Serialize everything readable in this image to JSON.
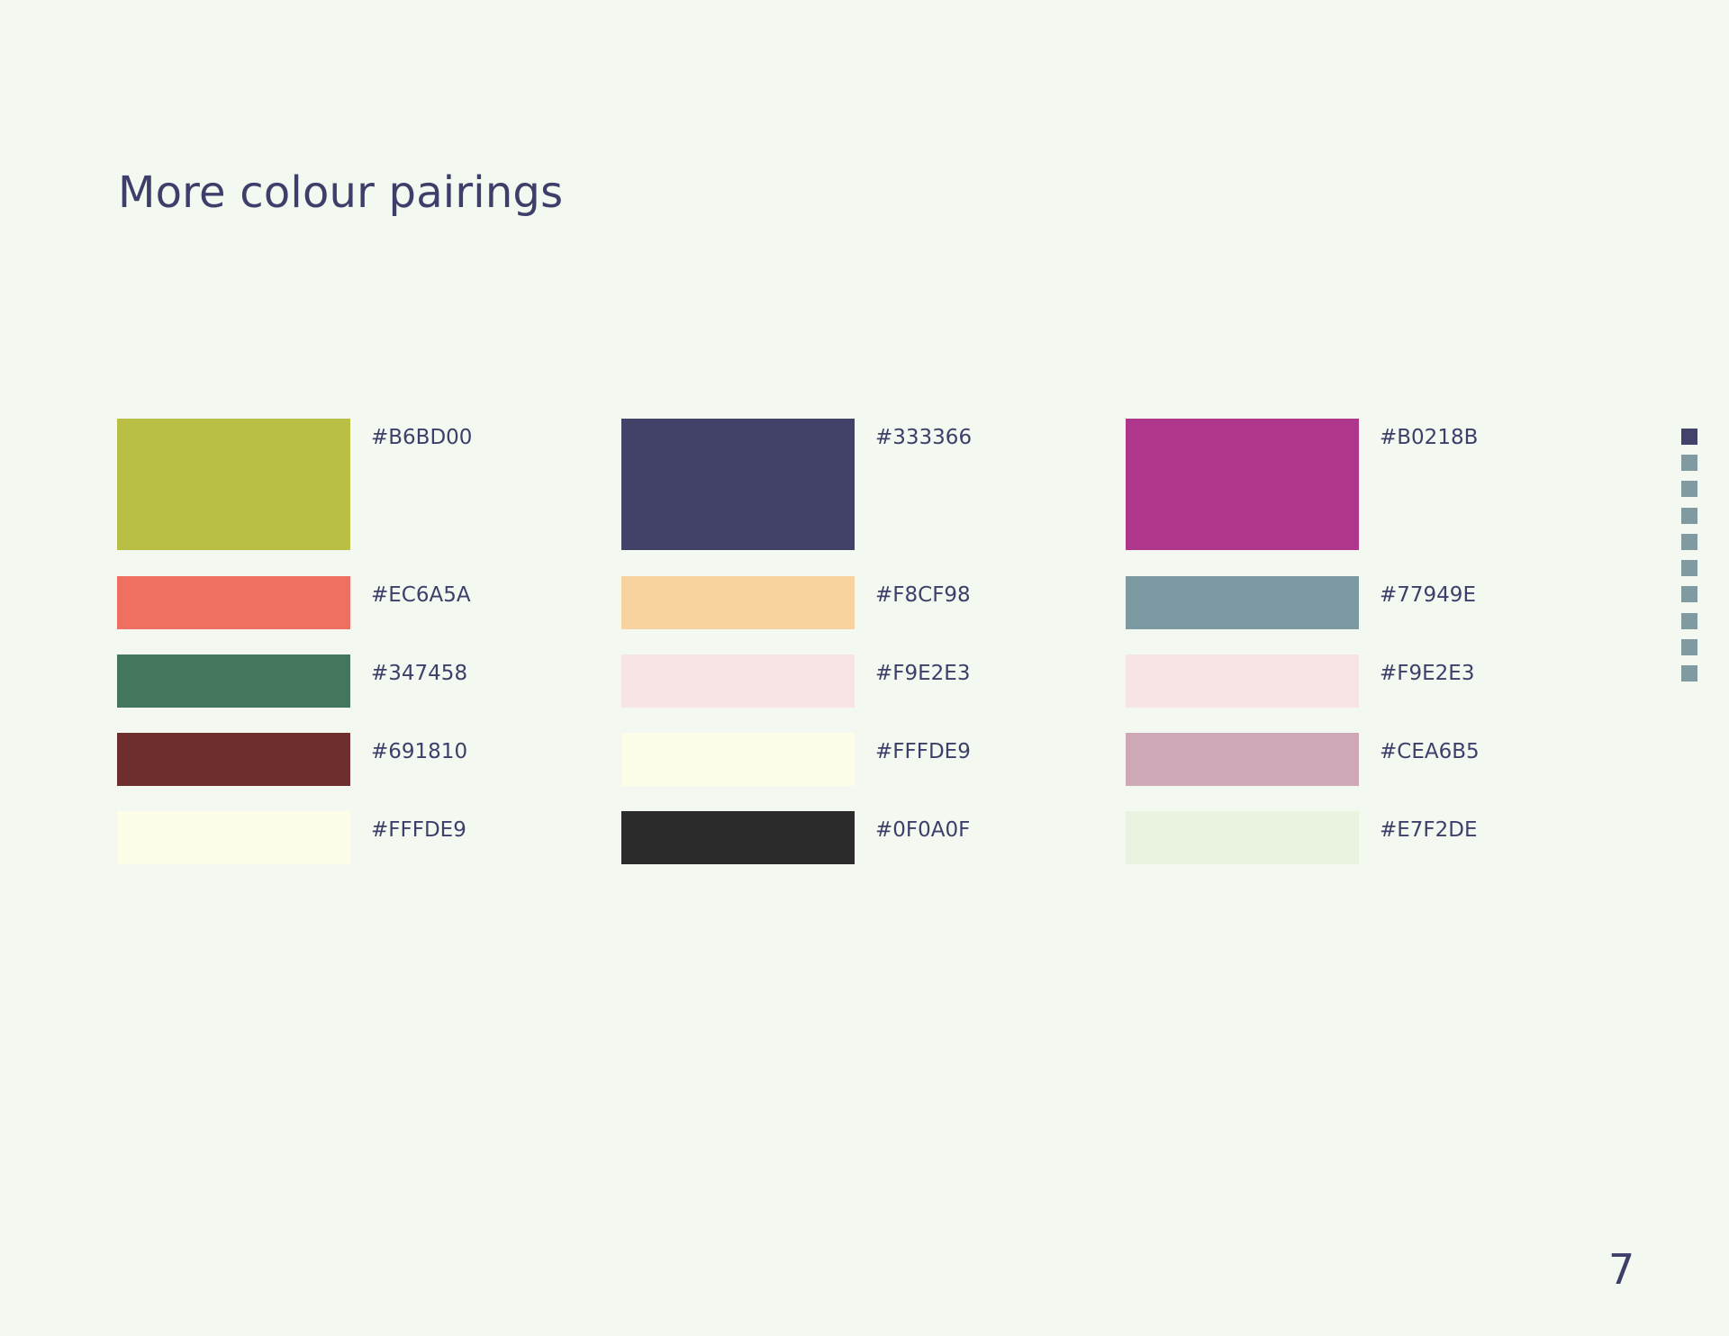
{
  "title": "More colour pairings",
  "page_number": "7",
  "palettes": [
    {
      "swatches": [
        {
          "hex": "#B6BD00",
          "color": "#B9BE44"
        },
        {
          "hex": "#EC6A5A",
          "color": "#EE7061"
        },
        {
          "hex": "#347458",
          "color": "#42775D"
        },
        {
          "hex": "#691810",
          "color": "#6E2E2E"
        },
        {
          "hex": "#FFFDE9",
          "color": "#FEFDEA"
        }
      ]
    },
    {
      "swatches": [
        {
          "hex": "#333366",
          "color": "#424168"
        },
        {
          "hex": "#F8CF98",
          "color": "#F9D39D"
        },
        {
          "hex": "#F9E2E3",
          "color": "#F8E4E4"
        },
        {
          "hex": "#FFFDE9",
          "color": "#FEFDEA"
        },
        {
          "hex": "#0F0A0F",
          "color": "#2B2B2B"
        }
      ]
    },
    {
      "swatches": [
        {
          "hex": "#B0218B",
          "color": "#AF378B"
        },
        {
          "hex": "#77949E",
          "color": "#7D99A1"
        },
        {
          "hex": "#F9E2E3",
          "color": "#F8E4E4"
        },
        {
          "hex": "#CEA6B5",
          "color": "#CEA8B6"
        },
        {
          "hex": "#E7F2DE",
          "color": "#E9F3DF"
        }
      ]
    }
  ],
  "page_nav": {
    "count": 10,
    "active_index": 0,
    "active_color": "#42426A",
    "inactive_color": "#7F9AA1"
  }
}
